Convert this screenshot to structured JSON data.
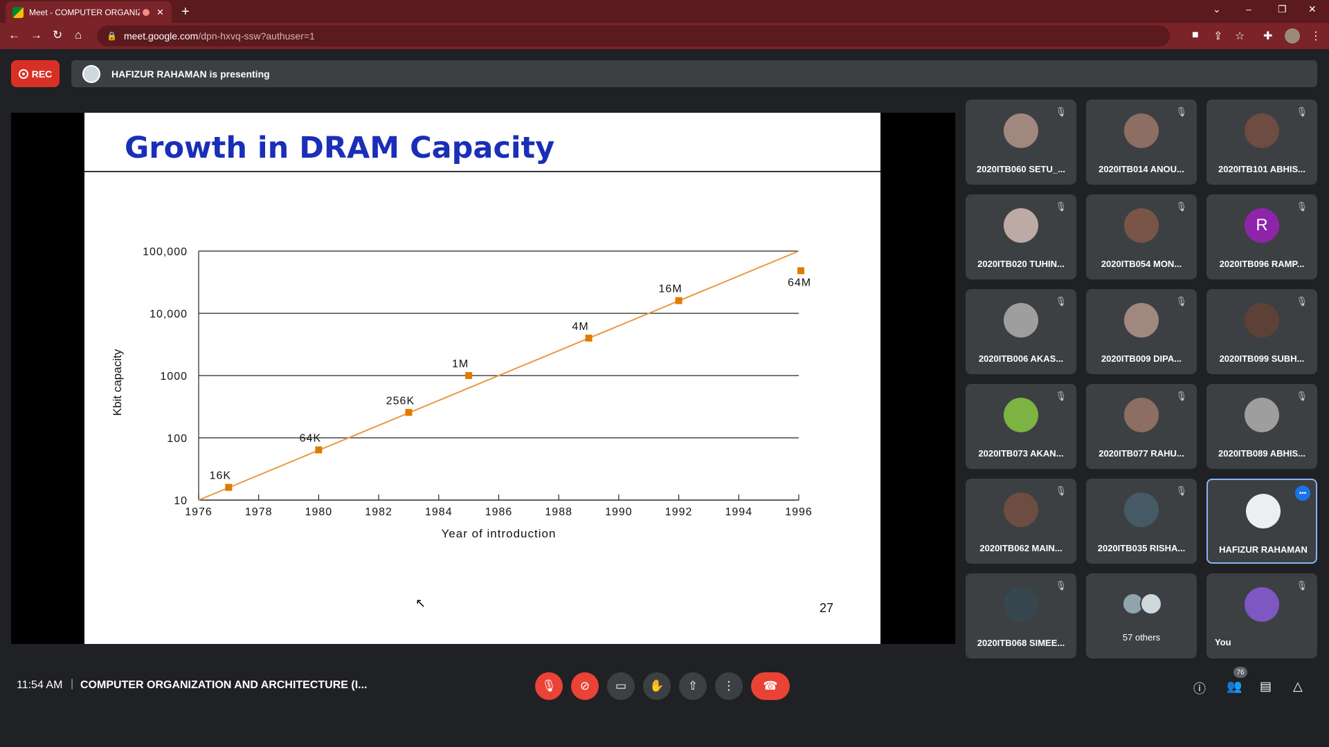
{
  "browser": {
    "tab_title": "Meet - COMPUTER ORGANIZ",
    "tab_close": "✕",
    "new_tab": "+",
    "url_host": "meet.google.com",
    "url_path": "/dpn-hxvq-ssw?authuser=1",
    "window_controls": [
      "⌄",
      "–",
      "❐",
      "✕"
    ]
  },
  "meet": {
    "rec_label": "REC",
    "presenting_text": "HAFIZUR RAHAMAN is presenting",
    "time": "11:54 AM",
    "separator": "|",
    "meeting_title": "COMPUTER ORGANIZATION AND ARCHITECTURE (I...",
    "participant_count": "76",
    "others_label": "57 others",
    "you_label": "You"
  },
  "slide": {
    "title": "Growth in DRAM Capacity",
    "page_number": "27"
  },
  "chart_data": {
    "type": "line",
    "title": "Growth in DRAM Capacity",
    "xlabel": "Year of introduction",
    "ylabel": "Kbit capacity",
    "xlim": [
      1976,
      1996
    ],
    "ylim": [
      10,
      100000
    ],
    "y_scale": "log",
    "x_ticks": [
      "1976",
      "1978",
      "1980",
      "1982",
      "1984",
      "1986",
      "1988",
      "1990",
      "1992",
      "1994",
      "1996"
    ],
    "y_ticks": [
      "10",
      "100",
      "1000",
      "10,000",
      "100,000"
    ],
    "points": [
      {
        "x": 1977,
        "y": 16,
        "label": "16K"
      },
      {
        "x": 1980,
        "y": 64,
        "label": "64K"
      },
      {
        "x": 1983,
        "y": 256,
        "label": "256K"
      },
      {
        "x": 1985,
        "y": 1000,
        "label": "1M"
      },
      {
        "x": 1989,
        "y": 4000,
        "label": "4M"
      },
      {
        "x": 1992,
        "y": 16000,
        "label": "16M"
      },
      {
        "x": 1996,
        "y": 64000,
        "label": "64M"
      }
    ],
    "trend_line": {
      "from": [
        1976,
        10
      ],
      "to": [
        1996,
        100000
      ]
    },
    "grid": true,
    "colors": {
      "marker": "#e07b00",
      "line": "#e89a3c"
    }
  },
  "tiles": [
    {
      "name": "2020ITB060 SETU_..."
    },
    {
      "name": "2020ITB014 ANOU..."
    },
    {
      "name": "2020ITB101 ABHIS..."
    },
    {
      "name": "2020ITB020 TUHIN..."
    },
    {
      "name": "2020ITB054 MON..."
    },
    {
      "name": "2020ITB096 RAMP...",
      "initial": "R"
    },
    {
      "name": "2020ITB006 AKAS..."
    },
    {
      "name": "2020ITB009 DIPA..."
    },
    {
      "name": "2020ITB099 SUBH..."
    },
    {
      "name": "2020ITB073 AKAN..."
    },
    {
      "name": "2020ITB077 RAHU..."
    },
    {
      "name": "2020ITB089 ABHIS..."
    },
    {
      "name": "2020ITB062 MAIN..."
    },
    {
      "name": "2020ITB035 RISHA..."
    },
    {
      "name": "HAFIZUR RAHAMAN"
    },
    {
      "name": "2020ITB068 SIMEE..."
    }
  ],
  "colors": {
    "accent_red": "#ea4335",
    "slide_title_blue": "#1a2fb8",
    "browser_frame": "#7a2328"
  }
}
